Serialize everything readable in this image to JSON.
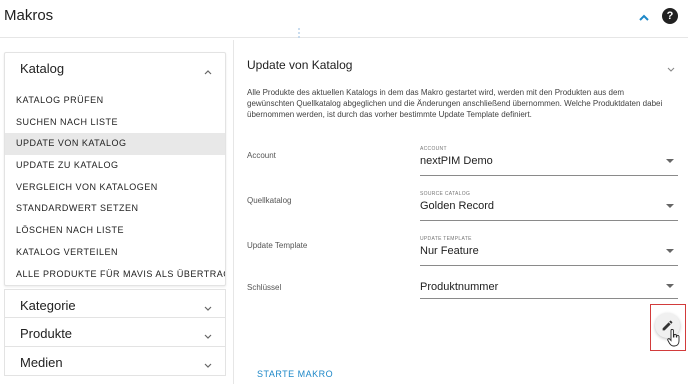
{
  "header": {
    "title": "Makros",
    "collapse_icon": "chevron-up-icon",
    "help_icon": "help-circle-icon",
    "help_glyph": "?"
  },
  "colors": {
    "accent": "#1e88c8",
    "selected_bg": "#e8e8e8",
    "highlight_frame": "#d23b3b"
  },
  "sidebar": {
    "open_group": {
      "label": "Katalog",
      "items": [
        {
          "label": "Katalog prüfen",
          "selected": false
        },
        {
          "label": "Suchen nach Liste",
          "selected": false
        },
        {
          "label": "Update von Katalog",
          "selected": true
        },
        {
          "label": "Update zu Katalog",
          "selected": false
        },
        {
          "label": "Vergleich von Katalogen",
          "selected": false
        },
        {
          "label": "Standardwert setzen",
          "selected": false
        },
        {
          "label": "Löschen nach Liste",
          "selected": false
        },
        {
          "label": "Katalog verteilen",
          "selected": false
        },
        {
          "label": "Alle Produkte für Mavis als übertragen...",
          "selected": false
        }
      ]
    },
    "closed_groups": [
      {
        "label": "Kategorie"
      },
      {
        "label": "Produkte"
      },
      {
        "label": "Medien"
      }
    ]
  },
  "main": {
    "title": "Update von Katalog",
    "description": "Alle Produkte des aktuellen Katalogs in dem das Makro gestartet wird, werden mit den Produkten aus dem gewünschten Quellkatalog abgeglichen und die Änderungen anschließend übernommen. Welche Produktdaten dabei übernommen werden, ist durch das vorher bestimmte Update Template definiert.",
    "fields": [
      {
        "label": "Account",
        "mini_label": "Account",
        "value": "nextPIM Demo"
      },
      {
        "label": "Quellkatalog",
        "mini_label": "Source Catalog",
        "value": "Golden Record"
      },
      {
        "label": "Update Template",
        "mini_label": "Update Template",
        "value": "Nur Feature"
      },
      {
        "label": "Schlüssel",
        "mini_label": "",
        "value": "Produktnummer"
      }
    ],
    "edit_icon": "pencil-icon",
    "start_button": "STARTE MAKRO"
  }
}
